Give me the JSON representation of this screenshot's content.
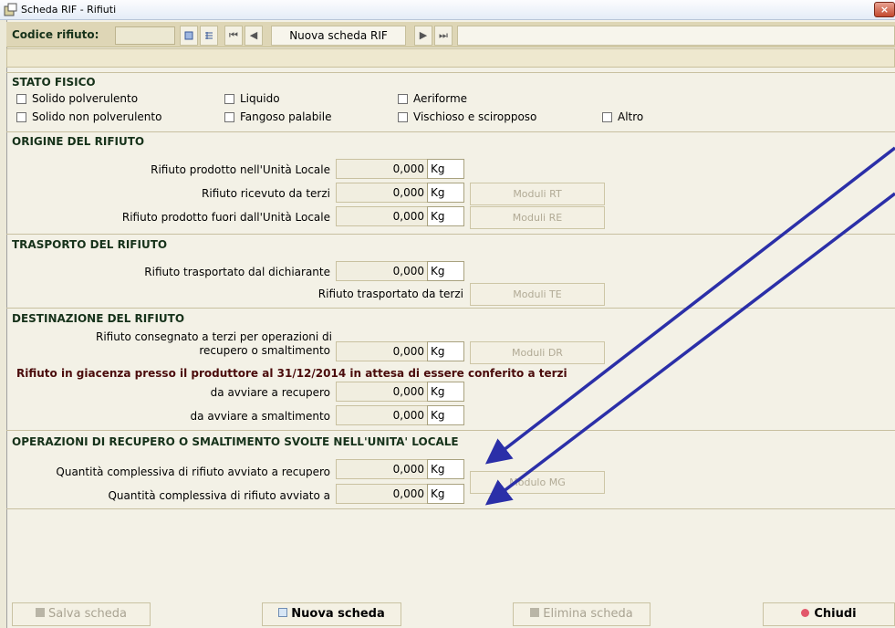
{
  "window": {
    "title": "Scheda RIF - Rifiuti",
    "close_glyph": "×"
  },
  "toolbar": {
    "code_label": "Codice rifiuto:",
    "code_value": "",
    "nav_title": "Nuova scheda RIF"
  },
  "stato_fisico": {
    "title": "STATO FISICO",
    "options": [
      "Solido polverulento",
      "Liquido",
      "Aeriforme",
      "Solido non polverulento",
      "Fangoso palabile",
      "Vischioso e sciropposo",
      "Altro"
    ]
  },
  "origine": {
    "title": "ORIGINE DEL RIFIUTO",
    "rows": [
      {
        "label": "Rifiuto prodotto nell'Unità Locale",
        "value": "0,000",
        "unit": "Kg"
      },
      {
        "label": "Rifiuto ricevuto da terzi",
        "value": "0,000",
        "unit": "Kg",
        "button": "Moduli RT"
      },
      {
        "label": "Rifiuto prodotto fuori dall'Unità Locale",
        "value": "0,000",
        "unit": "Kg",
        "button": "Moduli RE"
      }
    ]
  },
  "trasporto": {
    "title": "TRASPORTO DEL RIFIUTO",
    "rows": [
      {
        "label": "Rifiuto trasportato dal dichiarante",
        "value": "0,000",
        "unit": "Kg"
      },
      {
        "label": "Rifiuto trasportato da terzi",
        "button": "Moduli TE"
      }
    ]
  },
  "destinazione": {
    "title": "DESTINAZIONE DEL RIFIUTO",
    "consegnato_line1": "Rifiuto consegnato a terzi per operazioni di",
    "consegnato_line2": "recupero o smaltimento",
    "consegnato_value": "0,000",
    "consegnato_unit": "Kg",
    "consegnato_button": "Moduli DR",
    "giacenza": "Rifiuto in giacenza presso il produttore al 31/12/2014 in attesa di essere conferito a terzi",
    "rows": [
      {
        "label": "da avviare a recupero",
        "value": "0,000",
        "unit": "Kg"
      },
      {
        "label": "da avviare a smaltimento",
        "value": "0,000",
        "unit": "Kg"
      }
    ]
  },
  "operazioni": {
    "title": "OPERAZIONI DI RECUPERO O SMALTIMENTO SVOLTE NELL'UNITA' LOCALE",
    "rows": [
      {
        "label": "Quantità complessiva di rifiuto avviato a recupero",
        "value": "0,000",
        "unit": "Kg"
      },
      {
        "label": "Quantità complessiva di rifiuto avviato a",
        "value": "0,000",
        "unit": "Kg"
      }
    ],
    "button": "Modulo MG"
  },
  "bottom": {
    "salva": "Salva scheda",
    "nuova": "Nuova scheda",
    "elimina": "Elimina scheda",
    "chiudi": "Chiudi"
  },
  "colors": {
    "section_title": "#16321a",
    "giacenza_text": "#4a0b0b",
    "arrow": "#2b2fa8",
    "window_bg": "#f3f1e6",
    "toolbar_bg": "#ded6b6"
  },
  "icons": [
    "app-icon",
    "close-icon",
    "form-icon",
    "list-icon",
    "first-record-icon",
    "prev-record-icon",
    "next-record-icon",
    "last-record-icon",
    "save-icon",
    "new-icon",
    "delete-icon",
    "close-red-icon"
  ]
}
